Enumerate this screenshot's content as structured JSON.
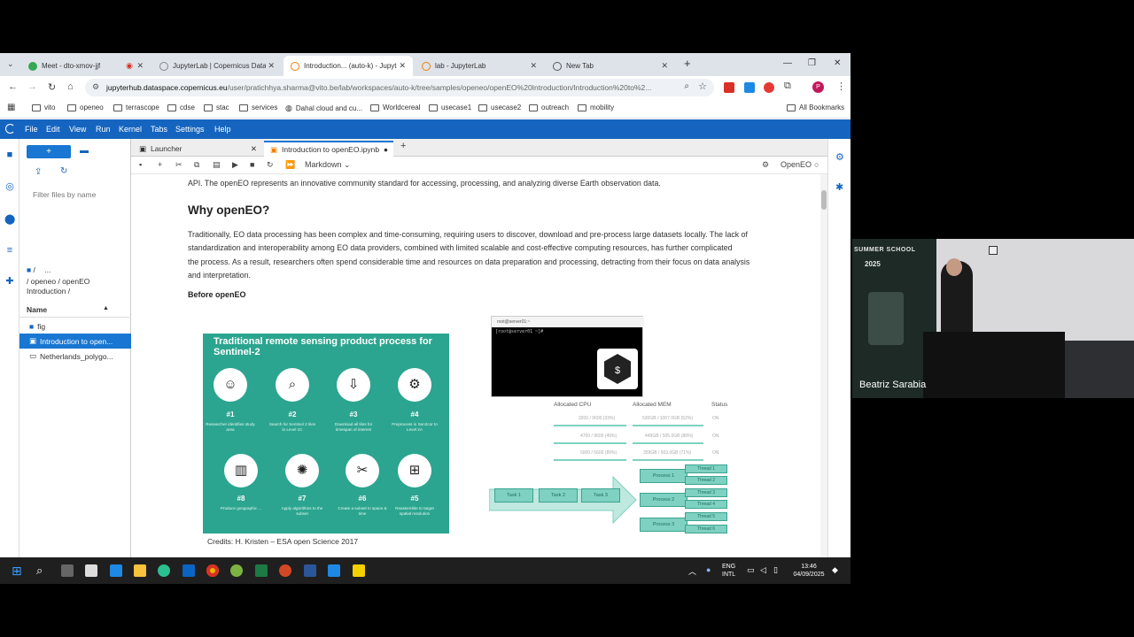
{
  "browser": {
    "tabs": [
      {
        "title": "Meet - dto-xmov-jjf",
        "color": "#34a853"
      },
      {
        "title": "JupyterLab | Copernicus Data S",
        "color": "#888888"
      },
      {
        "title": "Introduction... (auto-k) - Jupyte",
        "color": "#f57c00"
      },
      {
        "title": "lab - JupyterLab",
        "color": "#f57c00"
      },
      {
        "title": "New Tab",
        "color": "#555555"
      }
    ],
    "url_domain": "jupyterhub.dataspace.copernicus.eu",
    "url_path": "/user/pratichhya.sharma@vito.be/lab/workspaces/auto-k/tree/samples/openeo/openEO%20Introduction/Introduction%20to%2...",
    "bookmarks": [
      "vito",
      "openeo",
      "terrascope",
      "cdse",
      "stac",
      "services",
      "Dahal cloud and cu...",
      "Worldcereal",
      "usecase1",
      "usecase2",
      "outreach",
      "mobility",
      "All Bookmarks"
    ],
    "profile_initial": "P"
  },
  "jupyter": {
    "menu": [
      "File",
      "Edit",
      "View",
      "Run",
      "Kernel",
      "Tabs",
      "Settings",
      "Help"
    ],
    "new_label": "+",
    "filter_placeholder": "Filter files by name",
    "breadcrumb_root": "/",
    "breadcrumb_more": "...",
    "breadcrumb_path1": "/ openeo / openEO",
    "breadcrumb_path2": "Introduction /",
    "name_header": "Name",
    "files": [
      "fig",
      "Introduction to open...",
      "Netherlands_polygo..."
    ],
    "tabs": [
      "Launcher",
      "Introduction to openEO.ipynb"
    ],
    "cell_type": "Markdown",
    "kernel": "OpenEO"
  },
  "notebook": {
    "intro_tail": "API. The openEO represents an innovative community standard for accessing, processing, and analyzing diverse Earth observation data.",
    "heading": "Why openEO?",
    "line1": "Traditionally, EO data processing has been complex and time-consuming, requiring users to discover, download and pre-process large datasets locally. The lack of",
    "line2": "standardization and interoperability among EO data providers, combined with limited scalable and cost-effective computing resources, has further complicated",
    "line3": "the process. As a result, researchers often spend considerable time and resources on data preparation and processing, detracting from their focus on data analysis",
    "line4": "and interpretation.",
    "subheading": "Before openEO",
    "credits": "Credits: H. Kristen – ESA open Science 2017"
  },
  "figure_left": {
    "title": "Traditional remote sensing product process for Sentinel-2",
    "steps": [
      {
        "num": "#1",
        "caption": "Researcher identifies study area",
        "icon": "researcher-icon"
      },
      {
        "num": "#2",
        "caption": "Search for Sentinel 2 tiles in Level 1C",
        "icon": "magnifier-icon"
      },
      {
        "num": "#3",
        "caption": "Download all tiles for timespan of interest",
        "icon": "download-icon"
      },
      {
        "num": "#4",
        "caption": "Preprocess in Sen2cor to Level 2A",
        "icon": "gears-icon"
      },
      {
        "num": "#8",
        "caption": "Produce geographic ...",
        "icon": "map-icon"
      },
      {
        "num": "#7",
        "caption": "Apply algorithms to the subset",
        "icon": "lightbulb-icon"
      },
      {
        "num": "#6",
        "caption": "Create a subset in space & time",
        "icon": "scissors-icon"
      },
      {
        "num": "#5",
        "caption": "Reassemble to target spatial resolution",
        "icon": "grid-icon"
      }
    ]
  },
  "figure_right": {
    "terminal_title": "root@server01:~",
    "terminal_line": "[root@server01 ~]#",
    "terminal_glyph": "$",
    "col_cpu": "Allocated CPU",
    "col_mem": "Allocated MEM",
    "col_status": "Status",
    "rows": [
      {
        "cpu": "3200 / 9600 (33%)",
        "mem": "530GB / 1007.0GB (52%)",
        "status": "ON"
      },
      {
        "cpu": "4700 / 9600 (49%)",
        "mem": "449GB / 505.0GB (88%)",
        "status": "ON"
      },
      {
        "cpu": "5000 / 5600 (89%)",
        "mem": "359GB / 503.0GB (71%)",
        "status": "ON"
      }
    ],
    "tasks": [
      "Task 1",
      "Task 2",
      "Task 3"
    ],
    "processes": [
      "Process 1",
      "Process 2",
      "Process 3"
    ],
    "threads": [
      "Thread 1",
      "Thread 2",
      "Thread 3",
      "Thread 4",
      "Thread 5",
      "Thread 6"
    ]
  },
  "webcam": {
    "speaker": "Beatriz Sarabia",
    "banner_line1": "SUMMER SCHOOL",
    "banner_line2": "2025"
  },
  "taskbar": {
    "lang1": "ENG",
    "lang2": "INTL",
    "time": "13:46",
    "date": "04/09/2025"
  }
}
